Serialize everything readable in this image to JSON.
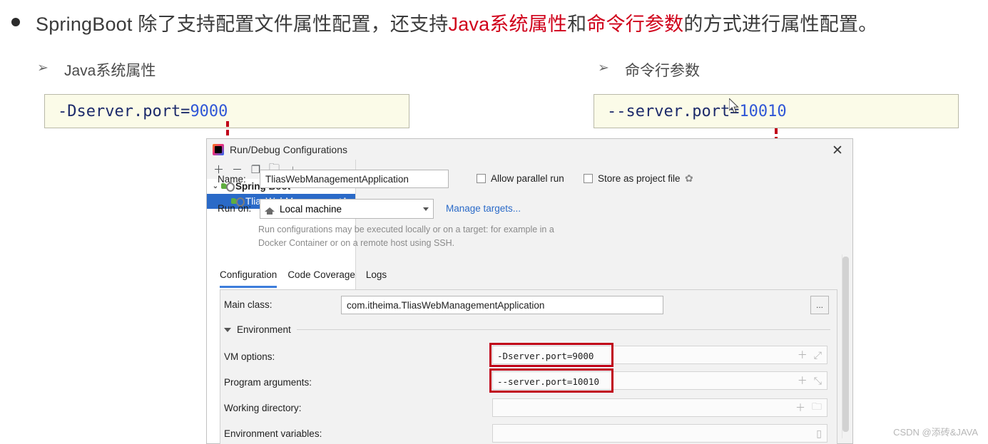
{
  "slide": {
    "bullet_text_parts": [
      {
        "text": "SpringBoot 除了支持配置文件属性配置，还支持",
        "color": "#3b3b3b"
      },
      {
        "text": "Java系统属性",
        "color": "#d0021b"
      },
      {
        "text": "和",
        "color": "#3b3b3b"
      },
      {
        "text": "命令行参数",
        "color": "#d0021b"
      },
      {
        "text": "的方式进行属性配置。",
        "color": "#3b3b3b"
      }
    ],
    "sub_heading_left": "Java系统属性",
    "sub_heading_right": "命令行参数",
    "arrow_marker": "➢",
    "code_left": {
      "prefix": "-Dserver.port=",
      "value": "9000"
    },
    "code_right": {
      "prefix": "--server.port=",
      "value": "10010"
    },
    "accent_red": "#d0021b",
    "code_bg": "#fbfbe8",
    "code_text_color": "#1d2b6b",
    "code_number_color": "#2f56d6"
  },
  "dialog": {
    "title": "Run/Debug Configurations",
    "close_label": "✕",
    "toolbar": [
      {
        "name": "add",
        "glyph": "＋"
      },
      {
        "name": "remove",
        "glyph": "－"
      },
      {
        "name": "copy",
        "glyph": "❐"
      },
      {
        "name": "new-folder",
        "glyph": "🗀"
      },
      {
        "name": "sort",
        "glyph": "↓"
      }
    ],
    "tree": {
      "group_label": "Spring Boot",
      "group_twisty": "⌄",
      "child_label": "TliasWebManagementA"
    },
    "name_label": "Name:",
    "name_value": "TliasWebManagementApplication",
    "allow_parallel_run": "Allow parallel run",
    "store_as_project_file": "Store as project file",
    "run_on_label": "Run on:",
    "run_on_value": "Local machine",
    "manage_targets": "Manage targets...",
    "run_on_hint": "Run configurations may be executed locally or on a target: for example in a Docker Container or on a remote host using SSH.",
    "tabs": [
      {
        "label": "Configuration",
        "active": true
      },
      {
        "label": "Code Coverage",
        "active": false
      },
      {
        "label": "Logs",
        "active": false
      }
    ],
    "main_class_label": "Main class:",
    "main_class_value": "com.itheima.TliasWebManagementApplication",
    "main_class_browse": "...",
    "environment_label": "Environment",
    "vm_options_label": "VM options:",
    "vm_options_value": "-Dserver.port=9000",
    "program_arguments_label": "Program arguments:",
    "program_arguments_value": "--server.port=10010",
    "working_directory_label": "Working directory:",
    "working_directory_value": "",
    "environment_variables_label": "Environment variables:",
    "environment_variables_value": "",
    "field_action_add": "＋",
    "field_action_expand": "⤢",
    "field_action_collapse": "⤡",
    "field_action_folder": "🗀",
    "field_action_doc": "▯"
  },
  "watermark": "CSDN @添砖&JAVA"
}
